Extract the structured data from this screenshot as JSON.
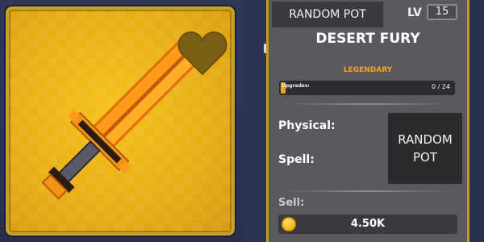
{
  "item": {
    "icon": "orange-twin-sword-icon",
    "favorite_icon": "heart-icon",
    "frame_color": "#c8a226"
  },
  "panel": {
    "tab_label": "RANDOM POT",
    "level_label": "LV",
    "level_value": "15",
    "name": "DESERT FURY",
    "rarity": "LEGENDARY",
    "rarity_color": "#f5a81d",
    "upgrades": {
      "label": "Upgrades:",
      "count": "0 / 24",
      "progress": 0.02
    },
    "stats": {
      "physical_label": "Physical:",
      "spell_label": "Spell:"
    },
    "pot_box": {
      "line1": "RANDOM",
      "line2": "POT"
    },
    "sell": {
      "label": "Sell:",
      "value": "4.50K",
      "icon": "gold-coin-icon"
    }
  }
}
